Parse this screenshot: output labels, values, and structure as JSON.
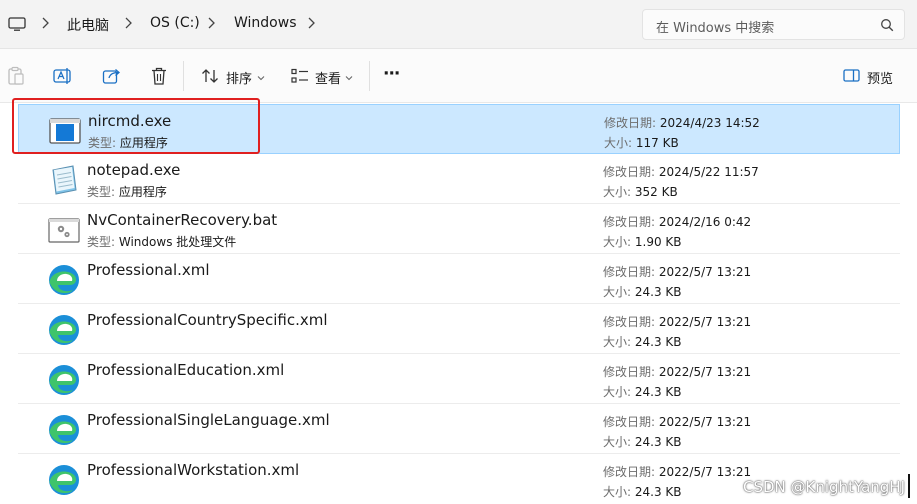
{
  "breadcrumb": {
    "items": [
      "此电脑",
      "OS (C:)",
      "Windows"
    ]
  },
  "search": {
    "placeholder": "在 Windows 中搜索"
  },
  "toolbar": {
    "sort_label": "排序",
    "view_label": "查看",
    "more_label": "···",
    "preview_label": "预览"
  },
  "labels": {
    "type": "类型:",
    "modified": "修改日期:",
    "size": "大小:"
  },
  "files": [
    {
      "name": "nircmd.exe",
      "type": "应用程序",
      "modified": "2024/4/23 14:52",
      "size": "117 KB",
      "icon": "nircmd-app-icon",
      "selected": true
    },
    {
      "name": "notepad.exe",
      "type": "应用程序",
      "modified": "2024/5/22 11:57",
      "size": "352 KB",
      "icon": "notepad-icon"
    },
    {
      "name": "NvContainerRecovery.bat",
      "type": "Windows 批处理文件",
      "modified": "2024/2/16 0:42",
      "size": "1.90 KB",
      "icon": "batch-file-icon"
    },
    {
      "name": "Professional.xml",
      "modified": "2022/5/7 13:21",
      "size": "24.3 KB",
      "icon": "edge-icon"
    },
    {
      "name": "ProfessionalCountrySpecific.xml",
      "modified": "2022/5/7 13:21",
      "size": "24.3 KB",
      "icon": "edge-icon"
    },
    {
      "name": "ProfessionalEducation.xml",
      "modified": "2022/5/7 13:21",
      "size": "24.3 KB",
      "icon": "edge-icon"
    },
    {
      "name": "ProfessionalSingleLanguage.xml",
      "modified": "2022/5/7 13:21",
      "size": "24.3 KB",
      "icon": "edge-icon"
    },
    {
      "name": "ProfessionalWorkstation.xml",
      "modified": "2022/5/7 13:21",
      "size": "24.3 KB",
      "icon": "edge-icon"
    }
  ],
  "watermark": "CSDN @KnightYangHJ",
  "colors": {
    "selection": "#cce8ff",
    "selection_border": "#99d1ff",
    "highlight_box": "#e02020",
    "accent": "#0067c0"
  }
}
